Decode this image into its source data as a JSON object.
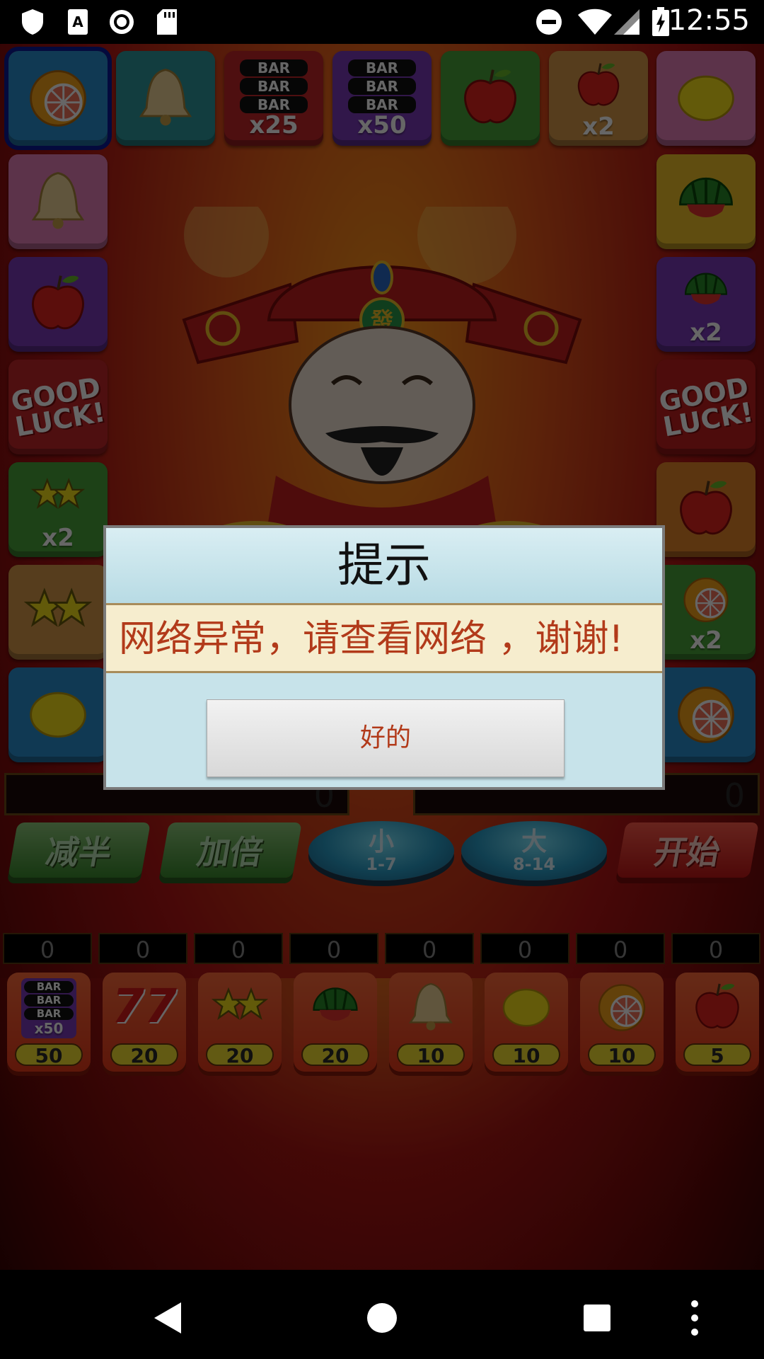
{
  "status_bar": {
    "time": "12:55",
    "icons": [
      "shield-icon",
      "keyboard-a-icon",
      "record-icon",
      "sd-card-icon",
      "do-not-disturb-icon",
      "wifi-icon",
      "signal-icon",
      "battery-charging-icon"
    ]
  },
  "board": {
    "top_row": [
      {
        "symbol": "orange",
        "color": "#2a8fd0",
        "mult": "",
        "selected": true
      },
      {
        "symbol": "bell",
        "color": "#2d9a9e",
        "mult": ""
      },
      {
        "symbol": "bar3",
        "color": "#c2262a",
        "mult": "x25"
      },
      {
        "symbol": "bar3",
        "color": "#7a3ab8",
        "mult": "x50"
      },
      {
        "symbol": "apple",
        "color": "#4aa33a",
        "mult": ""
      },
      {
        "symbol": "apple",
        "color": "#d89a4a",
        "mult": "x2"
      },
      {
        "symbol": "lemon",
        "color": "#e680b8",
        "mult": ""
      }
    ],
    "left_col": [
      {
        "symbol": "bell",
        "color": "#e680b8",
        "mult": ""
      },
      {
        "symbol": "apple",
        "color": "#7a3ab8",
        "mult": ""
      },
      {
        "symbol": "goodluck",
        "color": "#c2262a",
        "mult": ""
      },
      {
        "symbol": "stars",
        "color": "#4aa33a",
        "mult": "x2"
      },
      {
        "symbol": "stars",
        "color": "#d89a4a",
        "mult": ""
      },
      {
        "symbol": "lemon",
        "color": "#2a8fd0",
        "mult": ""
      }
    ],
    "right_col": [
      {
        "symbol": "watermelon",
        "color": "#f0c028",
        "mult": ""
      },
      {
        "symbol": "watermelon",
        "color": "#7a3ab8",
        "mult": "x2"
      },
      {
        "symbol": "goodluck",
        "color": "#c01e1e",
        "mult": ""
      },
      {
        "symbol": "apple",
        "color": "#e4852a",
        "mult": ""
      },
      {
        "symbol": "orange",
        "color": "#4aa33a",
        "mult": "x2"
      },
      {
        "symbol": "orange",
        "color": "#2a8fd0",
        "mult": ""
      }
    ],
    "bar_text": "BAR",
    "good_luck_text": "GOOD LUCK!"
  },
  "scores": {
    "left": "0",
    "right": "0"
  },
  "controls": {
    "half": "减半",
    "double": "加倍",
    "small": {
      "big": "小",
      "range": "1-7"
    },
    "large": {
      "big": "大",
      "range": "8-14"
    },
    "start": "开始"
  },
  "bets": [
    {
      "symbol": "bar3",
      "value": "50",
      "count": "0",
      "mult": "x50"
    },
    {
      "symbol": "seven",
      "value": "20",
      "count": "0",
      "mult": ""
    },
    {
      "symbol": "stars",
      "value": "20",
      "count": "0",
      "mult": ""
    },
    {
      "symbol": "watermelon",
      "value": "20",
      "count": "0",
      "mult": ""
    },
    {
      "symbol": "bell",
      "value": "10",
      "count": "0",
      "mult": ""
    },
    {
      "symbol": "lemon",
      "value": "10",
      "count": "0",
      "mult": ""
    },
    {
      "symbol": "orange",
      "value": "10",
      "count": "0",
      "mult": ""
    },
    {
      "symbol": "apple",
      "value": "5",
      "count": "0",
      "mult": ""
    }
  ],
  "seven_text": "77",
  "god_badge": "發",
  "dialog": {
    "title": "提示",
    "message": "网络异常，请查看网络 ，谢谢!",
    "ok": "好的"
  },
  "colors": {
    "dialog_bg": "#c7e3ea",
    "message_text": "#b23a1a",
    "message_bg": "#f6edce"
  },
  "nav": [
    "back-icon",
    "home-icon",
    "recents-icon",
    "overflow-menu-icon"
  ]
}
